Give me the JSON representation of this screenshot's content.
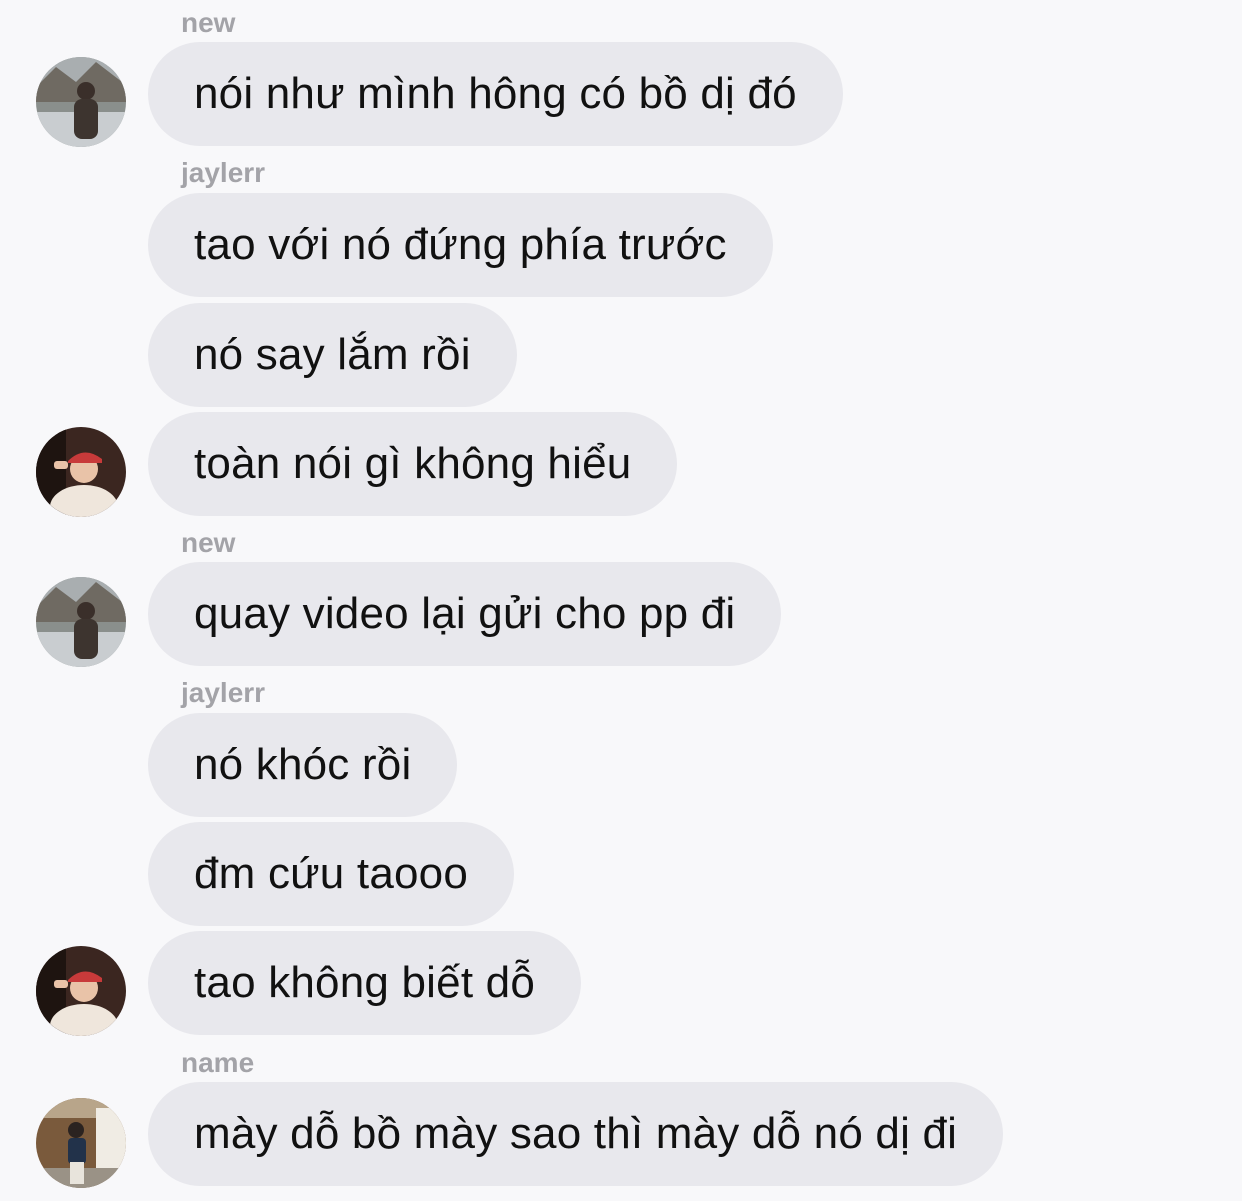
{
  "messages": {
    "senders": [
      "new",
      "jaylerr",
      "new",
      "jaylerr",
      "name"
    ],
    "texts": [
      "nói như mình hông có bồ dị đó",
      "tao với nó đứng phía trước",
      "nó say lắm rồi",
      "toàn nói gì không hiểu",
      "quay video lại gửi cho pp đi",
      "nó khóc rồi",
      "đm cứu taooo",
      "tao không biết dỗ",
      "mày dỗ bồ mày sao thì mày dỗ nó dị đi"
    ]
  },
  "colors": {
    "bubble": "#e8e8ed",
    "background": "#f8f8fa",
    "sender_name": "#a3a3a8",
    "text": "#111111"
  },
  "icons": {
    "avatar_new": "avatar-photo-outdoor-dark-jacket",
    "avatar_jaylerr": "avatar-photo-red-cap",
    "avatar_name": "avatar-photo-street"
  }
}
